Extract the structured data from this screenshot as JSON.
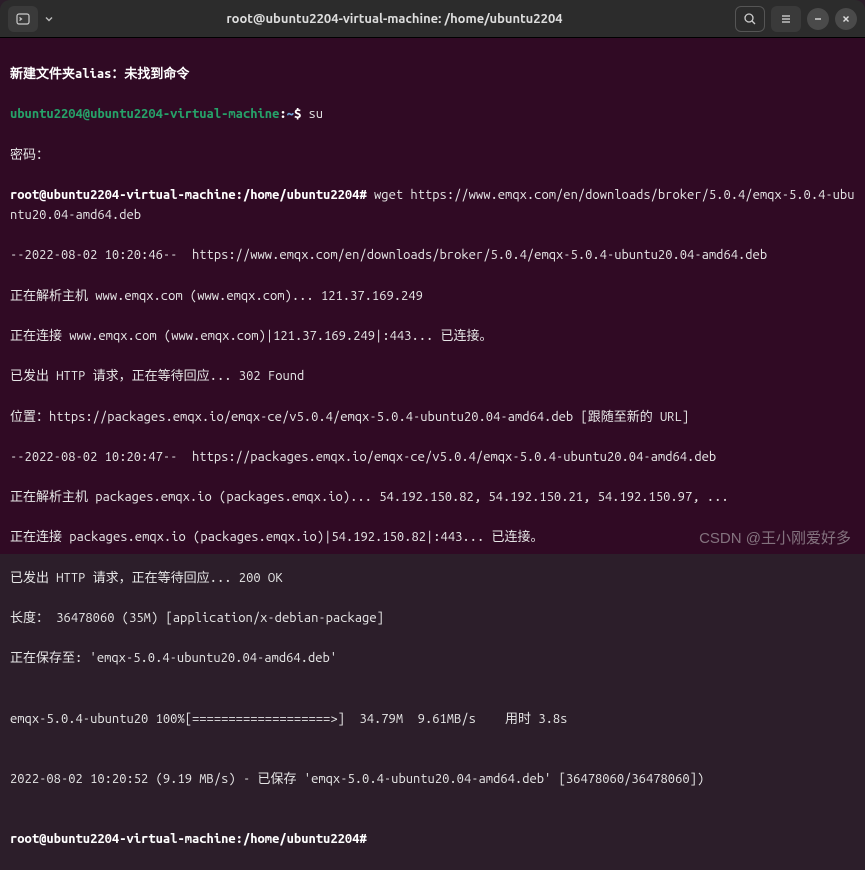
{
  "titlebar": {
    "title": "root@ubuntu2204-virtual-machine: /home/ubuntu2204"
  },
  "terminal": {
    "line1_text": "新建文件夹alias：未找到命令",
    "line2_user": "ubuntu2204@ubuntu2204-virtual-machine",
    "line2_sep": ":",
    "line2_path": "~",
    "line2_dollar": "$ ",
    "line2_cmd": "su",
    "line3_text": "密码：",
    "line4_prompt": "root@ubuntu2204-virtual-machine:/home/ubuntu2204# ",
    "line4_cmd": "wget https://www.emqx.com/en/downloads/broker/5.0.4/emqx-5.0.4-ubuntu20.04-amd64.deb",
    "line5_text": "--2022-08-02 10:20:46--  https://www.emqx.com/en/downloads/broker/5.0.4/emqx-5.0.4-ubuntu20.04-amd64.deb",
    "line6_text": "正在解析主机 www.emqx.com (www.emqx.com)... 121.37.169.249",
    "line7_text": "正在连接 www.emqx.com (www.emqx.com)|121.37.169.249|:443... 已连接。",
    "line8_text": "已发出 HTTP 请求，正在等待回应... 302 Found",
    "line9_text": "位置：https://packages.emqx.io/emqx-ce/v5.0.4/emqx-5.0.4-ubuntu20.04-amd64.deb [跟随至新的 URL]",
    "line10_text": "--2022-08-02 10:20:47--  https://packages.emqx.io/emqx-ce/v5.0.4/emqx-5.0.4-ubuntu20.04-amd64.deb",
    "line11_text": "正在解析主机 packages.emqx.io (packages.emqx.io)... 54.192.150.82, 54.192.150.21, 54.192.150.97, ...",
    "line12_text": "正在连接 packages.emqx.io (packages.emqx.io)|54.192.150.82|:443... 已连接。",
    "line13_text": "已发出 HTTP 请求，正在等待回应... 200 OK",
    "line14_text": "长度： 36478060 (35M) [application/x-debian-package]",
    "line15_text": "正在保存至: 'emqx-5.0.4-ubuntu20.04-amd64.deb'",
    "line16_blank": "",
    "line17_text": "emqx-5.0.4-ubuntu20 100%[===================>]  34.79M  9.61MB/s    用时 3.8s",
    "line18_blank": "",
    "line19_text": "2022-08-02 10:20:52 (9.19 MB/s) - 已保存 'emqx-5.0.4-ubuntu20.04-amd64.deb' [36478060/36478060])",
    "line20_blank": "",
    "line21_prompt": "root@ubuntu2204-virtual-machine:/home/ubuntu2204# "
  },
  "watermark": "CSDN @王小刚爱好多"
}
